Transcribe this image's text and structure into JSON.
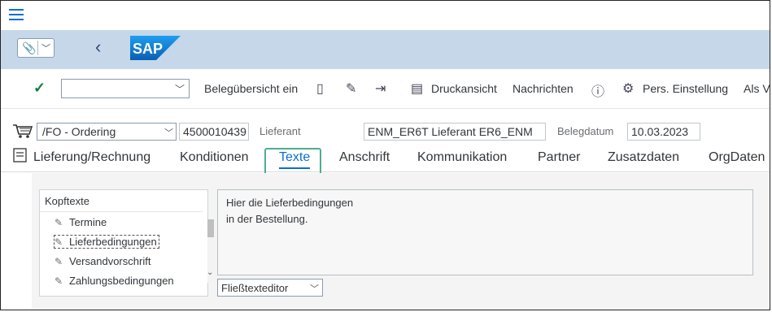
{
  "toolbar": {
    "items": [
      {
        "label": "Belegübersicht ein"
      },
      {
        "label": "Druckansicht"
      },
      {
        "label": "Nachrichten"
      },
      {
        "label": "Pers. Einstellung"
      },
      {
        "label": "Als V"
      }
    ]
  },
  "header": {
    "doc_type": "/FO - Ordering",
    "po_number": "4500010439",
    "vendor_label": "Lieferant",
    "vendor_value": "ENM_ER6T Lieferant ER6_ENM",
    "date_label": "Belegdatum",
    "date_value": "10.03.2023"
  },
  "tabs": [
    {
      "label": "Lieferung/Rechnung"
    },
    {
      "label": "Konditionen"
    },
    {
      "label": "Texte"
    },
    {
      "label": "Anschrift"
    },
    {
      "label": "Kommunikation"
    },
    {
      "label": "Partner"
    },
    {
      "label": "Zusatzdaten"
    },
    {
      "label": "OrgDaten"
    }
  ],
  "texts": {
    "header": "Kopftexte",
    "items": [
      {
        "label": "Termine"
      },
      {
        "label": "Lieferbedingungen"
      },
      {
        "label": "Versandvorschrift"
      },
      {
        "label": "Zahlungsbedingungen"
      }
    ],
    "selected_index": 1
  },
  "editor": {
    "lines": [
      "Hier die Lieferbedingungen",
      "in der Bestellung."
    ],
    "mode": "Fließtexteditor"
  },
  "colors": {
    "shell_bg": "#c5d7e9",
    "accent": "#0a6ed1",
    "highlight": "#4fae8f"
  }
}
